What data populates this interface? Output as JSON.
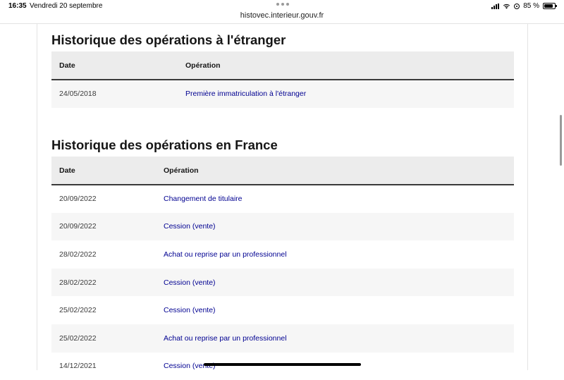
{
  "status_bar": {
    "time": "16:35",
    "date": "Vendredi 20 septembre",
    "url": "histovec.interieur.gouv.fr",
    "battery": "85 %",
    "icons": [
      "signal-icon",
      "wifi-icon",
      "location-icon",
      "battery-icon"
    ]
  },
  "foreign_history": {
    "title": "Historique des opérations à l'étranger",
    "headers": {
      "date": "Date",
      "operation": "Opération"
    },
    "rows": [
      {
        "date": "24/05/2018",
        "operation": "Première immatriculation à l'étranger"
      }
    ]
  },
  "france_history": {
    "title": "Historique des opérations en France",
    "headers": {
      "date": "Date",
      "operation": "Opération"
    },
    "rows": [
      {
        "date": "20/09/2022",
        "operation": "Changement de titulaire"
      },
      {
        "date": "20/09/2022",
        "operation": "Cession (vente)"
      },
      {
        "date": "28/02/2022",
        "operation": "Achat ou reprise par un professionnel"
      },
      {
        "date": "28/02/2022",
        "operation": "Cession (vente)"
      },
      {
        "date": "25/02/2022",
        "operation": "Cession (vente)"
      },
      {
        "date": "25/02/2022",
        "operation": "Achat ou reprise par un professionnel"
      },
      {
        "date": "14/12/2021",
        "operation": "Cession (vente)"
      }
    ]
  },
  "colors": {
    "link": "#000091",
    "header_bg": "#ececec",
    "row_alt_bg": "#f6f6f6",
    "header_border": "#3a3a3a"
  }
}
